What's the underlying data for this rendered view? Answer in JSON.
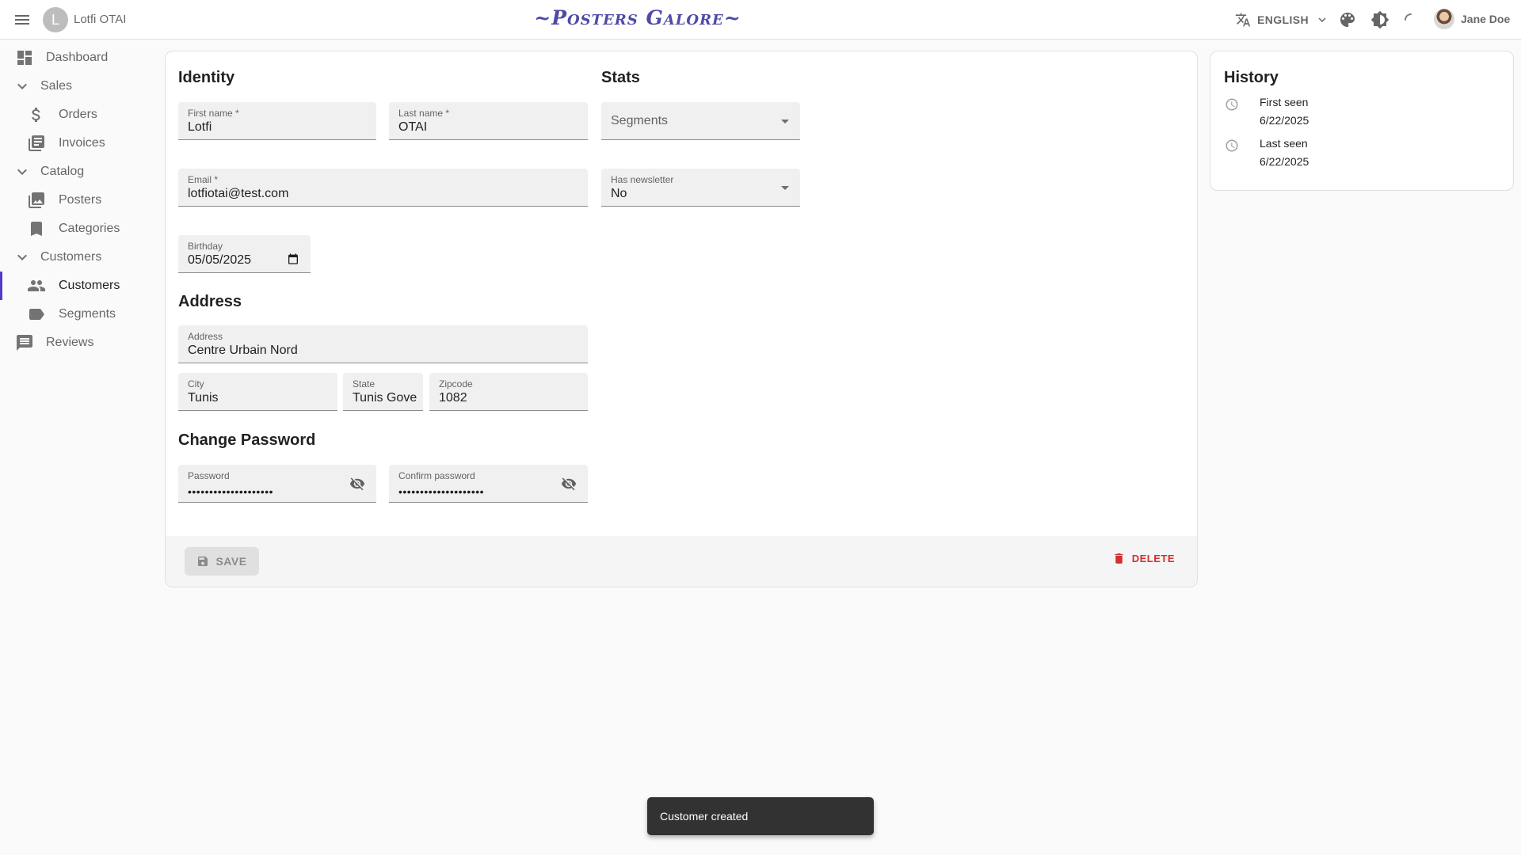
{
  "appbar": {
    "avatar_letter": "L",
    "page_title": "Lotfi OTAI",
    "logo": "~Posters Galore~",
    "language": "ENGLISH",
    "user_name": "Jane Doe"
  },
  "sidebar": {
    "dashboard": "Dashboard",
    "sales": "Sales",
    "orders": "Orders",
    "invoices": "Invoices",
    "catalog": "Catalog",
    "posters": "Posters",
    "categories": "Categories",
    "customers_group": "Customers",
    "customers": "Customers",
    "segments": "Segments",
    "reviews": "Reviews"
  },
  "form": {
    "identity_title": "Identity",
    "stats_title": "Stats",
    "address_title": "Address",
    "password_title": "Change Password",
    "first_name_label": "First name *",
    "first_name": "Lotfi",
    "last_name_label": "Last name *",
    "last_name": "OTAI",
    "email_label": "Email *",
    "email": "lotfiotai@test.com",
    "birthday_label": "Birthday",
    "birthday": "05/05/2025",
    "segments_placeholder": "Segments",
    "newsletter_label": "Has newsletter",
    "newsletter": "No",
    "address_label": "Address",
    "address": "Centre Urbain Nord",
    "city_label": "City",
    "city": "Tunis",
    "state_label": "State",
    "state": "Tunis Gove",
    "zipcode_label": "Zipcode",
    "zipcode": "1082",
    "password_label": "Password",
    "password_mask": "••••••••••••••••••••",
    "confirm_label": "Confirm password",
    "confirm_mask": "••••••••••••••••••••",
    "save": "SAVE",
    "delete": "DELETE"
  },
  "history": {
    "title": "History",
    "first_seen_label": "First seen",
    "first_seen": "6/22/2025",
    "last_seen_label": "Last seen",
    "last_seen": "6/22/2025"
  },
  "snackbar": {
    "message": "Customer created"
  }
}
